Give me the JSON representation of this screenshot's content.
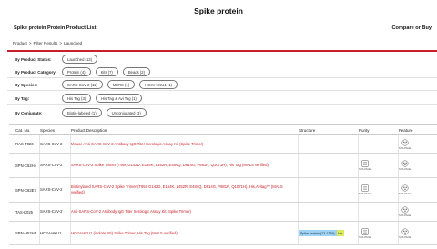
{
  "page": {
    "title": "Spike protein"
  },
  "header": {
    "list_title": "Spike protein Protein Product List",
    "compare_label": "Compare or Buy"
  },
  "breadcrumb": [
    "Product",
    ">",
    "Filter Results",
    ">",
    "Launched"
  ],
  "filters": [
    {
      "label": "By Product Status:",
      "chips": [
        "Launched (13)"
      ]
    },
    {
      "label": "By Product Category:",
      "chips": [
        "Protein (4)",
        "Kits (7)",
        "Beads (2)"
      ]
    },
    {
      "label": "By Species:",
      "chips": [
        "SARS-CoV-2 (11)",
        "MERS (1)",
        "HCoV-HKU1 (1)"
      ]
    },
    {
      "label": "By Tag:",
      "chips": [
        "His Tag (3)",
        "His Tag & Avi Tag (1)"
      ]
    },
    {
      "label": "By Conjugate:",
      "chips": [
        "Biotin-labeled (1)",
        "Unconjugated (3)"
      ]
    }
  ],
  "table": {
    "headers": [
      "Cat. No.",
      "Species",
      "Product Description",
      "Structure",
      "Purity",
      "Feature"
    ],
    "rows": [
      {
        "cat": "RAS-T023",
        "species": "SARS-CoV-2",
        "desc": "Mouse Anti-SARS-CoV-2 Antibody IgG Titer Serologic Assay Kit (Spike Trimer)",
        "structure": null,
        "purity": false
      },
      {
        "cat": "SPN-C52H4",
        "species": "SARS-CoV-2",
        "desc": "SARS-CoV-2 Spike Trimer (T95I, G142D, E154K, L452R, E484Q, D614G, P681R, Q1071H), His Tag (MALS verified)",
        "structure": null,
        "purity": true
      },
      {
        "cat": "SPN-C82E7",
        "species": "SARS-CoV-2",
        "desc": "Biotinylated SARS-CoV-2 Spike Trimer (T95I, G142D, E154K, L452R, E484Q, D614G, P681R, Q1071H), His,Avitag™ (MALS verified)",
        "structure": null,
        "purity": true
      },
      {
        "cat": "TAS-K025",
        "species": "SARS-CoV-2",
        "desc": "Anti-SARS-CoV-2 Antibody IgG Titer Serologic Assay Kit (Spike Trimer)",
        "structure": null,
        "purity": false
      },
      {
        "cat": "SPN-H52H5",
        "species": "HCoV-HKU1",
        "desc": "HCoV-HKU1 (isolate N5) Spike Trimer, His Tag (MALS verified)",
        "structure": {
          "label": "Spike protein (13-1276)",
          "tag": "His"
        },
        "purity": true
      }
    ]
  },
  "icons": {
    "purity": "sds-page-icon",
    "feature": "molecule-icon"
  },
  "labels": {
    "sds_page": "SDS-PAGE"
  },
  "colors": {
    "accent": "#c8202a",
    "structure_bar": "#9fd3f3",
    "tag_bar": "#d9ea5b"
  }
}
